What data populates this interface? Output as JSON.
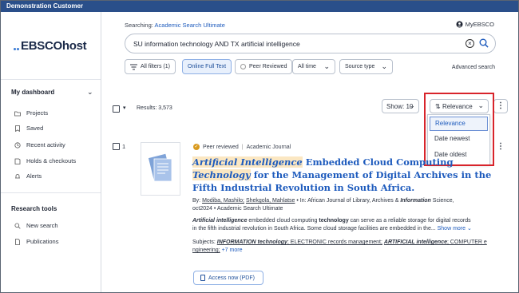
{
  "topbar": {
    "title": "Demonstration Customer"
  },
  "logo": {
    "text": "EBSCOhost"
  },
  "sidebar": {
    "dashboard_heading": "My dashboard",
    "dashboard_items": [
      {
        "label": "Projects",
        "icon": "folder-icon"
      },
      {
        "label": "Saved",
        "icon": "bookmark-icon"
      },
      {
        "label": "Recent activity",
        "icon": "history-icon"
      },
      {
        "label": "Holds & checkouts",
        "icon": "book-icon"
      },
      {
        "label": "Alerts",
        "icon": "bell-icon"
      }
    ],
    "tools_heading": "Research tools",
    "tools_items": [
      {
        "label": "New search",
        "icon": "search-icon"
      },
      {
        "label": "Publications",
        "icon": "document-icon"
      }
    ]
  },
  "header": {
    "searching_label": "Searching:",
    "database": "Academic Search Ultimate",
    "myebsco": "MyEBSCO"
  },
  "search": {
    "query": "SU information technology AND TX artificial intelligence"
  },
  "filters": {
    "all_filters": "All filters (1)",
    "full_text": "Online Full Text",
    "peer_reviewed": "Peer Reviewed",
    "time": "All time",
    "source_type": "Source type",
    "advanced": "Advanced search"
  },
  "results": {
    "count_label": "Results: 3,573",
    "show": "Show: 10",
    "sort": "Relevance"
  },
  "sort_menu": {
    "options": [
      "Relevance",
      "Date newest",
      "Date oldest"
    ],
    "selected": "Relevance"
  },
  "record": {
    "index": "1",
    "peer_reviewed": "Peer reviewed",
    "type": "Academic Journal",
    "title_part1": "Artificial Intelligence",
    "title_part2": " Embedded Cloud Computing ",
    "title_part3": "Technology",
    "title_part4": " for the Management of Digital Archives in the Fifth Industrial Revolution in South Africa.",
    "by_label": "By:",
    "author1": "Modiba, Mashilo;",
    "author2": "Shekgola, Mahlatse",
    "in_label": "In: African Journal of Library, Archives &",
    "in_term": "Information",
    "in_rest": "Science,",
    "date_line": "oct2024 • Academic Search Ultimate",
    "abstract_term1": "Artificial intelligence",
    "abstract_mid1": " embedded cloud computing ",
    "abstract_term2": "technology",
    "abstract_rest": " can serve as a reliable storage for digital records",
    "abstract_line2": "in the fifth industrial revolution in South Africa. Some cloud storage facilities are embedded in the...",
    "show_more": "Show more",
    "subjects_label": "Subjects:",
    "subject1": "INFORMATION technology",
    "subject2": "; ELECTRONIC records management;",
    "subject3": "ARTIFICIAL intelligence",
    "subject4": "; COMPUTER e",
    "subject5": "ngineering;",
    "more_subjects": "+7 more",
    "access": "Access now (PDF)"
  },
  "colors": {
    "topbar": "#2a4f8a",
    "link": "#1e5bbd",
    "highlight_box": "#d8242b"
  }
}
